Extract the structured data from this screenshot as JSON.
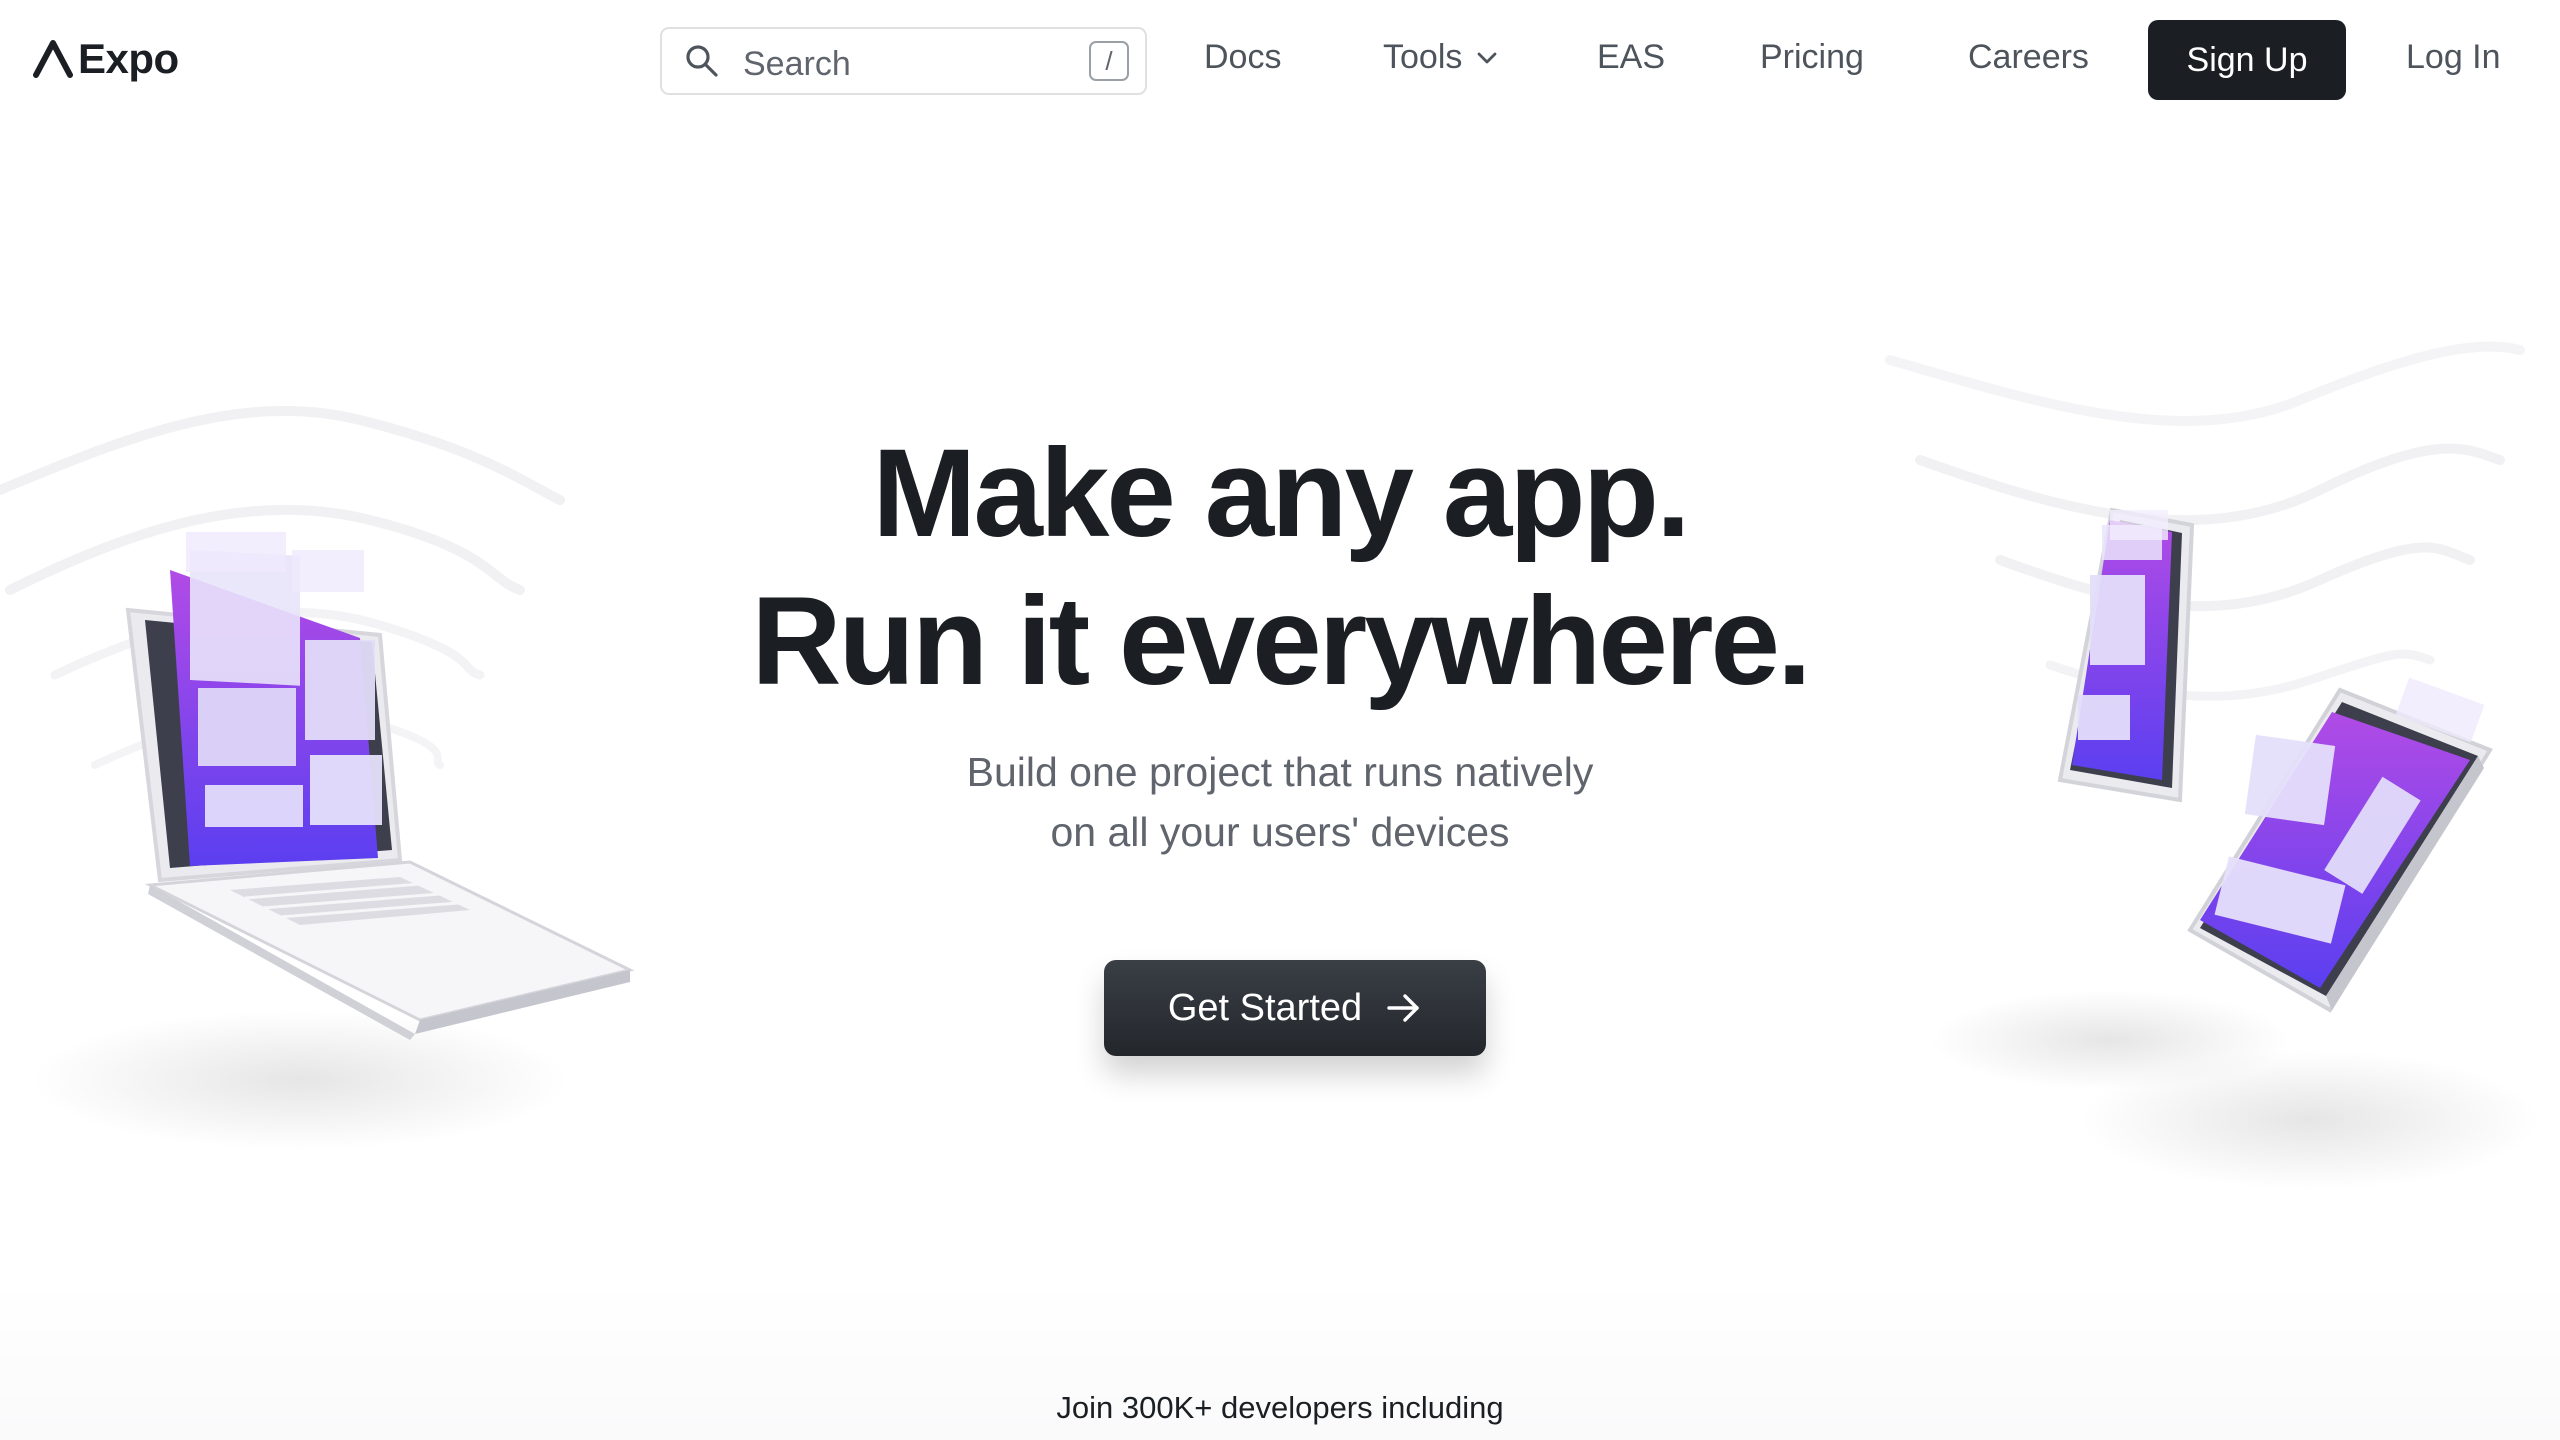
{
  "brand": {
    "name": "Expo",
    "accent_purple": "#8b5cf6",
    "dark": "#1b1f23"
  },
  "nav": {
    "search": {
      "placeholder": "Search",
      "shortcut": "/"
    },
    "links": {
      "docs": "Docs",
      "tools": "Tools",
      "eas": "EAS",
      "pricing": "Pricing",
      "careers": "Careers",
      "login": "Log In"
    },
    "signup_label": "Sign Up",
    "icons": {
      "search": "search-icon",
      "tools_dropdown": "chevron-down-icon"
    }
  },
  "hero": {
    "title_line1": "Make any app.",
    "title_line2": "Run it everywhere.",
    "subtitle_line1": "Build one project that runs natively",
    "subtitle_line2": "on all your users' devices",
    "cta_label": "Get Started",
    "cta_icon": "arrow-right-icon"
  },
  "social_proof": {
    "text": "Join 300K+ developers including"
  },
  "illustrations": {
    "left": "laptop-illustration",
    "right": "phone-and-tablet-illustration"
  }
}
